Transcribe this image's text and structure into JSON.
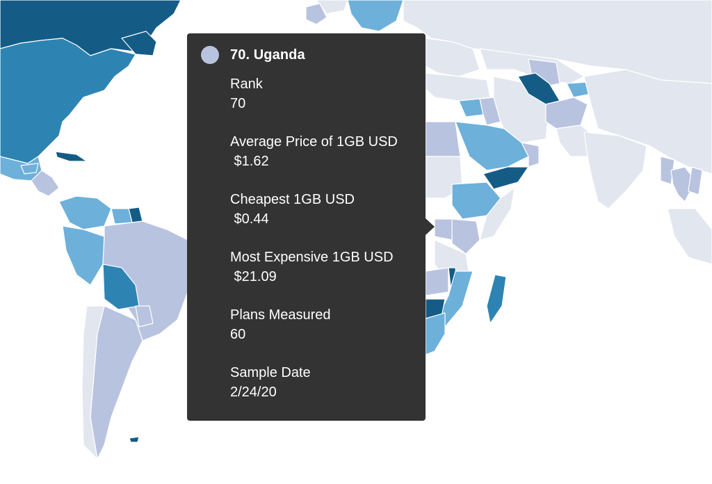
{
  "tooltip": {
    "swatch_color": "#b8c3e0",
    "title": "70. Uganda",
    "rows": [
      {
        "label": "Rank",
        "value": "70"
      },
      {
        "label": "Average Price of 1GB USD",
        "value": " $1.62"
      },
      {
        "label": "Cheapest 1GB USD",
        "value": " $0.44"
      },
      {
        "label": "Most Expensive 1GB USD",
        "value": " $21.09"
      },
      {
        "label": "Plans Measured",
        "value": "60"
      },
      {
        "label": "Sample Date",
        "value": "2/24/20"
      }
    ]
  },
  "map": {
    "palette": {
      "darkest": "#145c86",
      "dark": "#2d84b3",
      "medium": "#6db0da",
      "light": "#b8c3e0",
      "lightest": "#e2e6ef",
      "background": "#ffffff"
    }
  }
}
